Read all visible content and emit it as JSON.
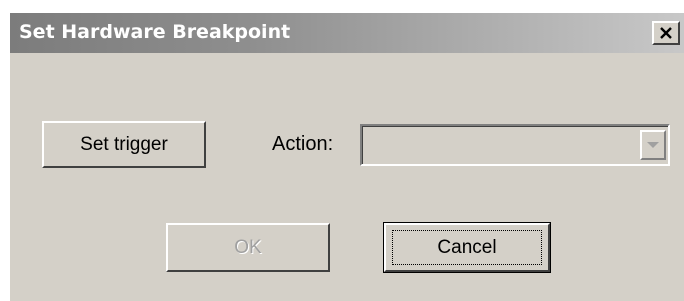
{
  "dialog": {
    "title": "Set Hardware Breakpoint",
    "close_glyph": "✕",
    "close_icon": "close-icon"
  },
  "trigger": {
    "button_label": "Set trigger"
  },
  "action": {
    "label": "Action:",
    "selected_value": "",
    "enabled": false,
    "arrow_icon": "chevron-down-icon"
  },
  "footer": {
    "ok_label": "OK",
    "ok_enabled": false,
    "cancel_label": "Cancel",
    "cancel_focused": true
  },
  "colors": {
    "face": "#d4d0c8",
    "title_start": "#7c7c7c",
    "title_end": "#c8c8c8",
    "title_text": "#ffffff",
    "disabled_text": "#a0a0a0"
  }
}
